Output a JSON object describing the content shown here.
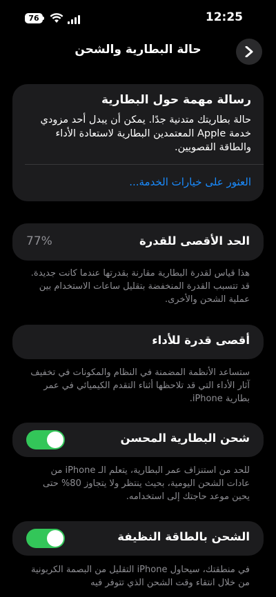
{
  "status_bar": {
    "battery_level": "76",
    "time": "12:25",
    "wifi_icon": "wifi-icon",
    "signal_icon": "cellular-signal-icon"
  },
  "nav": {
    "title": "حالة البطارية والشحن",
    "back_icon": "chevron-right-icon"
  },
  "notice": {
    "title": "رسالة مهمة حول البطارية",
    "body": "حالة بطاريتك متدنية جدًا. يمكن أن يبدل أحد مزودي خدمة Apple المعتمدين البطارية لاستعادة الأداء والطاقة القصويين.",
    "link": "العثور على خيارات الخدمة..."
  },
  "max_capacity": {
    "label": "الحد الأقصى للقدرة",
    "value": "77%",
    "footnote": "هذا قياس لقدرة البطارية مقارنة بقدرتها عندما كانت جديدة. قد تتسبب القدرة المنخفضة بتقليل ساعات الاستخدام بين عملية الشحن والأخرى."
  },
  "peak_performance": {
    "label": "أقصى قدرة للأداء",
    "footnote": "ستساعد الأنظمة المضمنة في النظام والمكونات في تخفيف آثار الأداء التي قد تلاحظها أثناء التقدم الكيميائي في عمر بطارية iPhone."
  },
  "optimized_charging": {
    "label": "شحن البطارية المحسن",
    "enabled": true,
    "footnote": "للحد من استنزاف عمر البطارية، يتعلم الـ iPhone من عادات الشحن اليومية، بحيث ينتظر ولا يتجاوز 80% حتى يحين موعد حاجتك إلى استخدامه."
  },
  "clean_energy": {
    "label": "الشحن بالطاقة النظيفة",
    "enabled": true,
    "footnote": "في منطقتك، سيحاول iPhone التقليل من البصمة الكربونية من خلال انتقاء وقت الشحن الذي تتوفر فيه"
  },
  "colors": {
    "background": "#000000",
    "card": "#1c1c1e",
    "link": "#1a8cff",
    "toggle_on": "#33c659",
    "secondary_text": "#8e8e93"
  }
}
